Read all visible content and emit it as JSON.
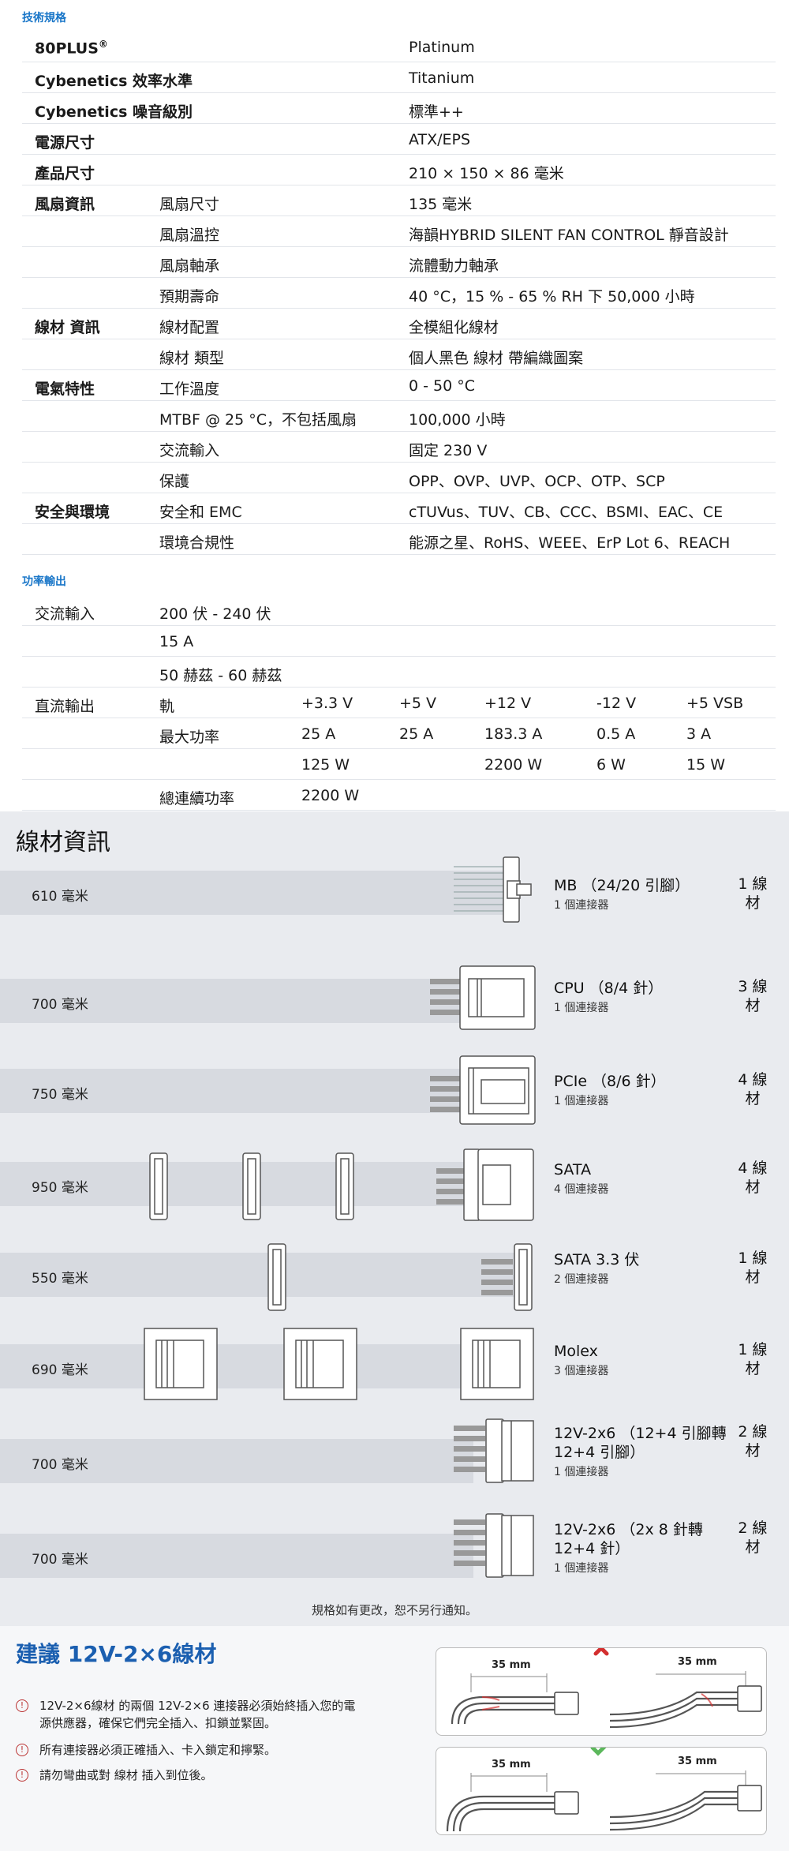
{
  "spec": {
    "section_title": "技術規格",
    "rows": [
      {
        "c1": "80PLUS",
        "sup": "®",
        "c2": "",
        "c3": "Platinum"
      },
      {
        "c1": "Cybenetics 效率水準",
        "c2": "",
        "c3": "Titanium"
      },
      {
        "c1": "Cybenetics 噪音級別",
        "c2": "",
        "c3": "標準++"
      },
      {
        "c1": "電源尺寸",
        "c2": "",
        "c3": "ATX/EPS"
      },
      {
        "c1": "產品尺寸",
        "c2": "",
        "c3": "210 × 150 × 86 毫米"
      },
      {
        "c1": "風扇資訊",
        "c2": "風扇尺寸",
        "c3": "135 毫米"
      },
      {
        "c1": "",
        "c2": "風扇溫控",
        "c3": "海韻HYBRID SILENT FAN CONTROL 靜音設計"
      },
      {
        "c1": "",
        "c2": "風扇軸承",
        "c3": "流體動力軸承"
      },
      {
        "c1": "",
        "c2": "預期壽命",
        "c3": "40 °C，15 % - 65 % RH 下 50,000 小時"
      },
      {
        "c1": "線材 資訊",
        "c2": "線材配置",
        "c3": "全模組化線材"
      },
      {
        "c1": "",
        "c2": "線材 類型",
        "c3": "個人黑色 線材 帶編織圖案"
      },
      {
        "c1": "電氣特性",
        "c2": "工作溫度",
        "c3": "0 - 50 °C"
      },
      {
        "c1": "",
        "c2": "MTBF @ 25 °C，不包括風扇",
        "c3": "100,000 小時"
      },
      {
        "c1": "",
        "c2": "交流輸入",
        "c3": "固定 230 V"
      },
      {
        "c1": "",
        "c2": "保護",
        "c3": "OPP、OVP、UVP、OCP、OTP、SCP"
      },
      {
        "c1": "安全與環境",
        "c2": "安全和 EMC",
        "c3": "cTUVus、TUV、CB、CCC、BSMI、EAC、CE"
      },
      {
        "c1": "",
        "c2": "環境合規性",
        "c3": "能源之星、RoHS、WEEE、ErP Lot 6、REACH"
      }
    ]
  },
  "power": {
    "section_title": "功率輸出",
    "rows": [
      {
        "c1": "交流輸入",
        "c2": "200 伏 - 240 伏",
        "cells": [
          "",
          "",
          "",
          "",
          ""
        ]
      },
      {
        "c1": "",
        "c2": "15 A",
        "cells": [
          "",
          "",
          "",
          "",
          ""
        ]
      },
      {
        "c1": "",
        "c2": "50 赫茲 - 60 赫茲",
        "cells": [
          "",
          "",
          "",
          "",
          ""
        ]
      },
      {
        "c1": "直流輸出",
        "c2": "軌",
        "cells": [
          "+3.3 V",
          "+5 V",
          "+12 V",
          "-12 V",
          "+5 VSB"
        ]
      },
      {
        "c1": "",
        "c2": "最大功率",
        "cells": [
          "25 A",
          "25 A",
          "183.3 A",
          "0.5 A",
          "3 A"
        ]
      },
      {
        "c1": "",
        "c2": "",
        "cells": [
          "125 W",
          "",
          "2200 W",
          "6 W",
          "15 W"
        ]
      },
      {
        "c1": "",
        "c2": "總連續功率",
        "cells": [
          "2200 W",
          "",
          "",
          "",
          ""
        ]
      }
    ]
  },
  "cables": {
    "title": "線材資訊",
    "items": [
      {
        "length": "610 毫米",
        "name": "MB （24/20 引腳）",
        "count": "1 個連接器",
        "qty": "1 線材"
      },
      {
        "length": "700 毫米",
        "name": "CPU （8/4 針）",
        "count": "1 個連接器",
        "qty": "3 線材"
      },
      {
        "length": "750 毫米",
        "name": "PCIe （8/6 針）",
        "count": "1 個連接器",
        "qty": "4 線材"
      },
      {
        "length": "950 毫米",
        "name": "SATA",
        "count": "4 個連接器",
        "qty": "4 線材"
      },
      {
        "length": "550 毫米",
        "name": "SATA 3.3 伏",
        "count": "2 個連接器",
        "qty": "1 線材"
      },
      {
        "length": "690 毫米",
        "name": "Molex",
        "count": "3 個連接器",
        "qty": "1 線材"
      },
      {
        "length": "700 毫米",
        "name": "12V-2x6 （12+4 引腳轉 12+4 引腳）",
        "count": "1 個連接器",
        "qty": "2 線材"
      },
      {
        "length": "700 毫米",
        "name": "12V-2x6 （2x 8 針轉 12+4 針）",
        "count": "1 個連接器",
        "qty": "2 線材"
      }
    ],
    "note": "規格如有更改，恕不另行通知。"
  },
  "recommend": {
    "title": "建議 12V-2×6線材",
    "tips": [
      "12V-2×6線材 的兩個 12V-2×6 連接器必須始終插入您的電源供應器，確保它們完全插入、扣鎖並緊固。",
      "所有連接器必須正確插入、卡入鎖定和擰緊。",
      "請勿彎曲或對 線材 插入到位後。"
    ],
    "dim_label": "35 mm",
    "colors": {
      "bad": "#d32f2f",
      "good": "#5cb85c",
      "accent": "#1b5fb0"
    }
  }
}
